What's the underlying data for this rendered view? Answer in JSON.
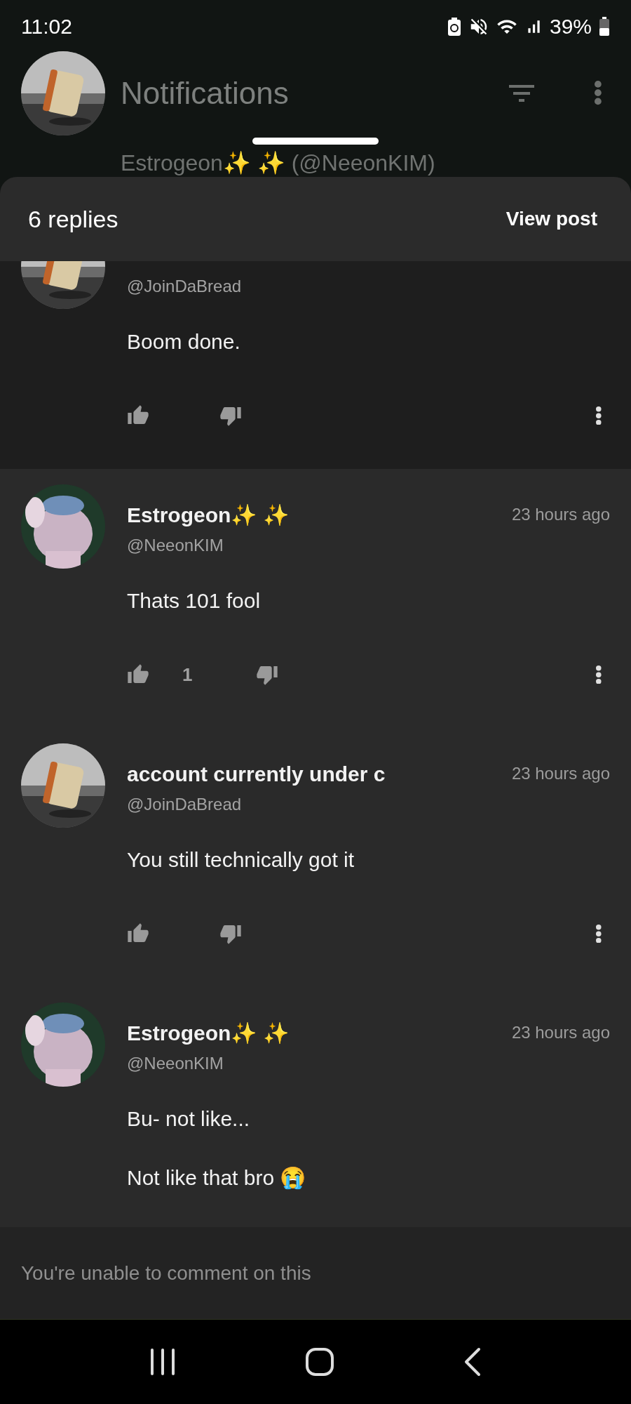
{
  "status_bar": {
    "time": "11:02",
    "battery": "39%"
  },
  "app_bar": {
    "title": "Notifications"
  },
  "background_item": {
    "text": "Estrogeon✨ ✨ (@NeeonKIM)"
  },
  "sheet": {
    "title": "6 replies",
    "action": "View post"
  },
  "comments": [
    {
      "handle": "@JoinDaBread",
      "paragraphs": [
        "Boom done."
      ],
      "votes_shown": true,
      "highlighted": true
    },
    {
      "name": "Estrogeon✨ ✨",
      "time": "23 hours ago",
      "handle": "@NeeonKIM",
      "paragraphs": [
        "Thats 101 fool"
      ],
      "likes": "1",
      "votes_shown": true,
      "highlighted": false
    },
    {
      "name": "account currently under c",
      "time": "23 hours ago",
      "handle": "@JoinDaBread",
      "paragraphs": [
        "You still technically got it"
      ],
      "votes_shown": true,
      "highlighted": false
    },
    {
      "name": "Estrogeon✨ ✨",
      "time": "23 hours ago",
      "handle": "@NeeonKIM",
      "paragraphs": [
        "Bu- not like...",
        "Not like that bro 😭"
      ],
      "votes_shown": false,
      "highlighted": false
    }
  ],
  "footer": {
    "notice": "You're unable to comment on this"
  }
}
